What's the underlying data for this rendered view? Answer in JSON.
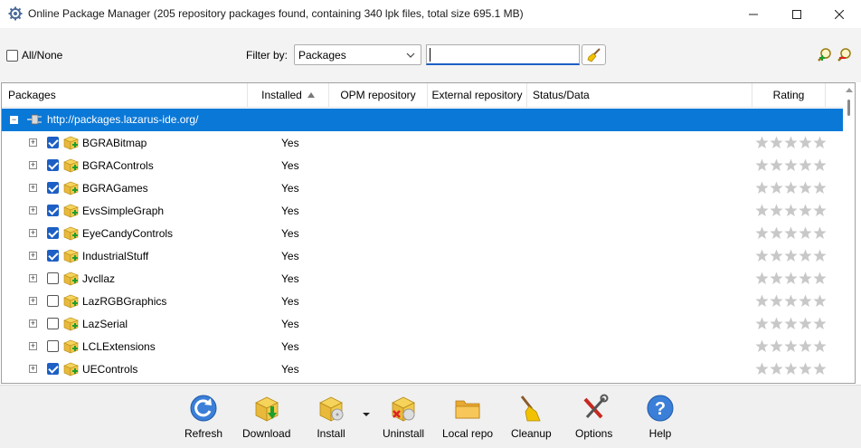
{
  "window": {
    "title": "Online Package Manager (205 repository packages found, containing 340 lpk files, total size 695.1 MB)",
    "icon": "lazarus-gear-icon",
    "controls": [
      "minimize-icon",
      "maximize-icon",
      "close-icon"
    ]
  },
  "filterbar": {
    "all_none_label": "All/None",
    "filter_label": "Filter by:",
    "filter_selected": "Packages",
    "filter_value": "",
    "clear_icon": "broom-icon",
    "zoom_in_icon": "zoom-in-icon",
    "zoom_out_icon": "zoom-out-icon"
  },
  "grid": {
    "columns": [
      "Packages",
      "Installed",
      "OPM repository",
      "External repository",
      "Status/Data",
      "Rating"
    ],
    "sorted_column": "Installed",
    "repository": "http://packages.lazarus-ide.org/",
    "rows": [
      {
        "name": "BGRABitmap",
        "checked": true,
        "installed": "Yes",
        "rating": 0
      },
      {
        "name": "BGRAControls",
        "checked": true,
        "installed": "Yes",
        "rating": 0
      },
      {
        "name": "BGRAGames",
        "checked": true,
        "installed": "Yes",
        "rating": 0
      },
      {
        "name": "EvsSimpleGraph",
        "checked": true,
        "installed": "Yes",
        "rating": 0
      },
      {
        "name": "EyeCandyControls",
        "checked": true,
        "installed": "Yes",
        "rating": 0
      },
      {
        "name": "IndustrialStuff",
        "checked": true,
        "installed": "Yes",
        "rating": 0
      },
      {
        "name": "Jvcllaz",
        "checked": false,
        "installed": "Yes",
        "rating": 0
      },
      {
        "name": "LazRGBGraphics",
        "checked": false,
        "installed": "Yes",
        "rating": 0
      },
      {
        "name": "LazSerial",
        "checked": false,
        "installed": "Yes",
        "rating": 0
      },
      {
        "name": "LCLExtensions",
        "checked": false,
        "installed": "Yes",
        "rating": 0
      },
      {
        "name": "UEControls",
        "checked": true,
        "installed": "Yes",
        "rating": 0
      }
    ]
  },
  "toolbar": {
    "refresh": "Refresh",
    "download": "Download",
    "install": "Install",
    "uninstall": "Uninstall",
    "local_repo": "Local repo",
    "cleanup": "Cleanup",
    "options": "Options",
    "help": "Help"
  },
  "colors": {
    "selection": "#0a78d7",
    "accent": "#1d5fc4"
  }
}
